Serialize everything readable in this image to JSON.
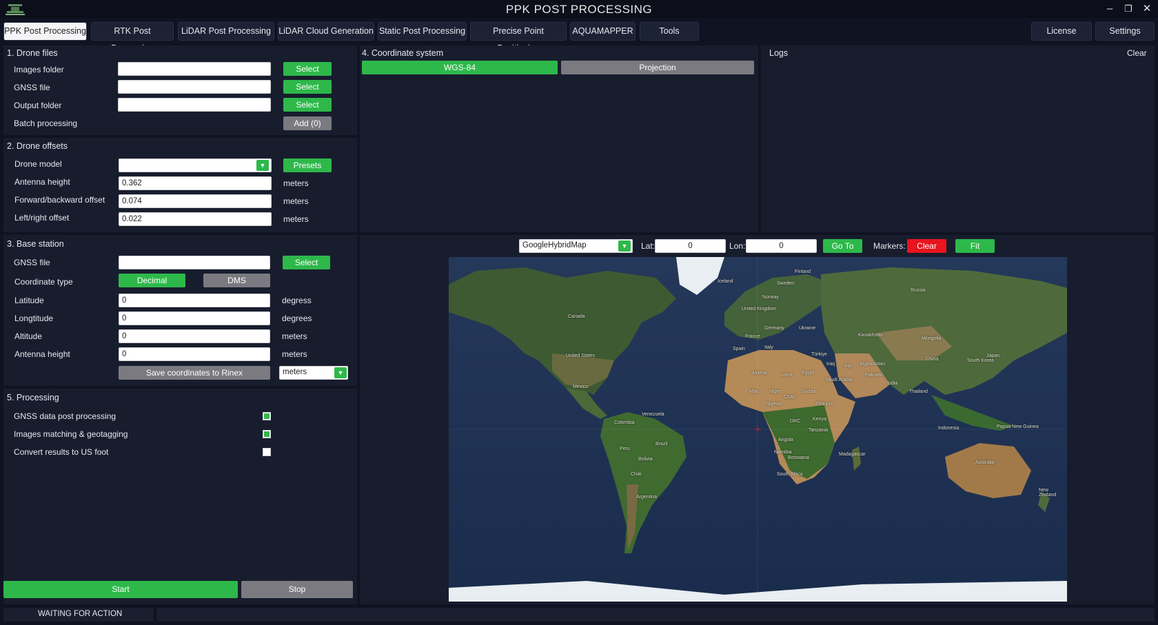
{
  "app": {
    "title": "PPK POST PROCESSING"
  },
  "tabs": [
    {
      "label": "PPK Post Processing",
      "active": true
    },
    {
      "label": "RTK Post Processing"
    },
    {
      "label": "LiDAR Post Processing"
    },
    {
      "label": "LiDAR Cloud Generation"
    },
    {
      "label": "Static Post Processing"
    },
    {
      "label": "Precise Point Positioning"
    },
    {
      "label": "AQUAMAPPER"
    },
    {
      "label": "Tools"
    }
  ],
  "right_tabs": [
    {
      "label": "License"
    },
    {
      "label": "Settings"
    }
  ],
  "drone_files": {
    "title": "1. Drone files",
    "rows": [
      {
        "label": "Images folder",
        "value": "",
        "button": "Select"
      },
      {
        "label": "GNSS file",
        "value": "",
        "button": "Select"
      },
      {
        "label": "Output folder",
        "value": "",
        "button": "Select"
      }
    ],
    "batch_label": "Batch processing",
    "batch_button": "Add (0)"
  },
  "drone_offsets": {
    "title": "2. Drone offsets",
    "model_label": "Drone model",
    "model_value": "",
    "presets_button": "Presets",
    "rows": [
      {
        "label": "Antenna height",
        "value": "0.362",
        "unit": "meters"
      },
      {
        "label": "Forward/backward offset",
        "value": "0.074",
        "unit": "meters"
      },
      {
        "label": "Left/right offset",
        "value": "0.022",
        "unit": "meters"
      }
    ]
  },
  "base_station": {
    "title": "3. Base station",
    "gnss_label": "GNSS file",
    "gnss_value": "",
    "gnss_button": "Select",
    "coord_type_label": "Coordinate type",
    "decimal_button": "Decimal",
    "dms_button": "DMS",
    "rows": [
      {
        "label": "Latitude",
        "value": "0",
        "unit": "degress"
      },
      {
        "label": "Longtitude",
        "value": "0",
        "unit": "degrees"
      },
      {
        "label": "Altitude",
        "value": "0",
        "unit": "meters"
      },
      {
        "label": "Antenna height",
        "value": "0",
        "unit": "meters"
      }
    ],
    "save_button": "Save coordinates to Rinex",
    "unit_select": "meters"
  },
  "processing": {
    "title": "5. Processing",
    "options": [
      {
        "label": "GNSS data post processing",
        "checked": true
      },
      {
        "label": "Images matching & geotagging",
        "checked": true
      },
      {
        "label": "Convert results to US foot",
        "checked": false
      }
    ]
  },
  "actions": {
    "start": "Start",
    "stop": "Stop"
  },
  "coordinate_system": {
    "title": "4. Coordinate system",
    "wgs_button": "WGS-84",
    "projection_button": "Projection"
  },
  "logs": {
    "title": "Logs",
    "clear": "Clear"
  },
  "map_toolbar": {
    "provider": "GoogleHybridMap",
    "lat_label": "Lat:",
    "lat_value": "0",
    "lon_label": "Lon:",
    "lon_value": "0",
    "goto_button": "Go To",
    "markers_label": "Markers:",
    "clear_button": "Clear",
    "fit_button": "Fit"
  },
  "map_labels": [
    "Canada",
    "United States",
    "Mexico",
    "Venezuela",
    "Colombia",
    "Peru",
    "Brazil",
    "Bolivia",
    "Chile",
    "Argentina",
    "Iceland",
    "Sweden",
    "Finland",
    "Norway",
    "United Kingdom",
    "Germany",
    "Ukraine",
    "France",
    "Spain",
    "Italy",
    "Algeria",
    "Libya",
    "Egypt",
    "Mali",
    "Niger",
    "Chad",
    "Sudan",
    "Nigeria",
    "Ethiopia",
    "DRC",
    "Kenya",
    "Tanzania",
    "Angola",
    "Namibia",
    "Botswana",
    "Madagascar",
    "South Africa",
    "Türkiye",
    "Iraq",
    "Iran",
    "Saudi Arabia",
    "Kazakhstan",
    "Russia",
    "Mongolia",
    "China",
    "Japan",
    "South Korea",
    "Afghanistan",
    "Pakistan",
    "India",
    "Thailand",
    "Indonesia",
    "Papua New Guinea",
    "Australia",
    "New Zealand"
  ],
  "status": {
    "text": "WAITING FOR ACTION"
  },
  "colors": {
    "accent_green": "#2eb84a",
    "danger_red": "#e8141e",
    "panel_bg": "#181d2e"
  }
}
